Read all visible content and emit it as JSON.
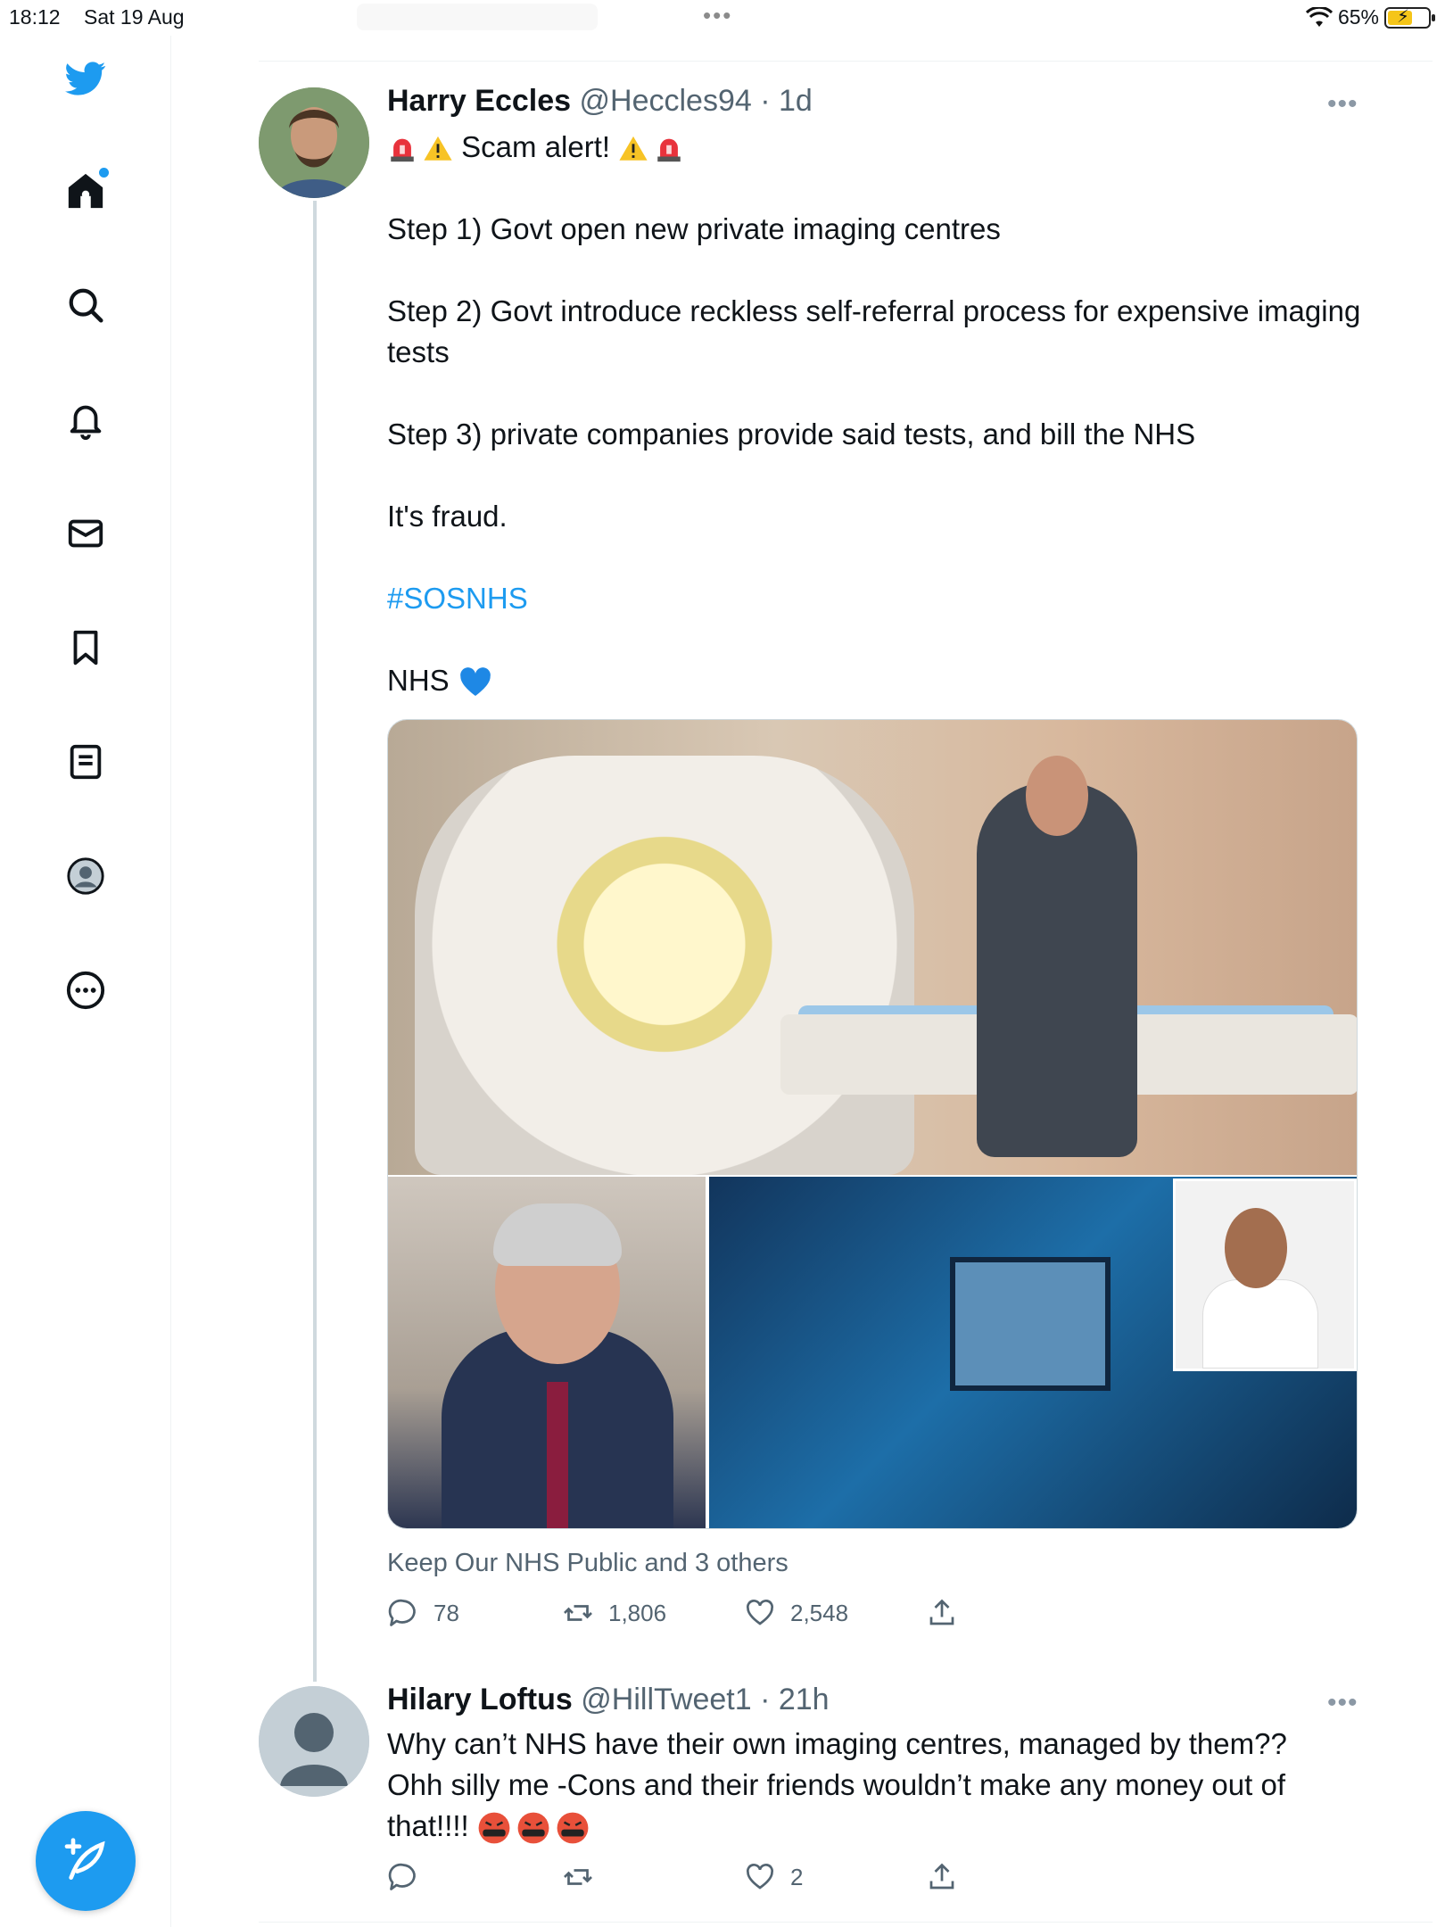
{
  "status_bar": {
    "time": "18:12",
    "date": "Sat 19 Aug",
    "battery": "65%"
  },
  "icons": {
    "app_logo": "twitter-bird-icon",
    "nav": [
      "home-icon",
      "search-icon",
      "bell-icon",
      "mail-icon",
      "bookmark-icon",
      "list-icon",
      "profile-icon",
      "more-circle-icon"
    ],
    "compose": "compose-feather-icon"
  },
  "colors": {
    "accent": "#1d9bf0",
    "text": "#0f1419",
    "muted": "#536471"
  },
  "tweet": {
    "name": "Harry Eccles",
    "handle": "@Heccles94",
    "time": "· 1d",
    "more_label": "•••",
    "headline": "Scam alert!",
    "step1": "Step 1) Govt open new private imaging centres",
    "step2": "Step 2) Govt introduce reckless self-referral process for expensive imaging tests",
    "step3": "Step 3) private companies provide said tests, and bill the NHS",
    "fraud": "It's fraud.",
    "hashtag": "#SOSNHS",
    "nhs_line": "NHS",
    "social_context": "Keep Our NHS Public and 3 others",
    "replies": "78",
    "retweets": "1,806",
    "likes": "2,548"
  },
  "reply": {
    "name": "Hilary Loftus",
    "handle": "@HillTweet1",
    "time": "· 21h",
    "more_label": "•••",
    "line1": "Why can’t NHS have their own imaging centres, managed by them??",
    "line2": "Ohh silly me -Cons and their friends wouldn’t make any money out of",
    "line3": "that!!!!",
    "likes": "2"
  }
}
